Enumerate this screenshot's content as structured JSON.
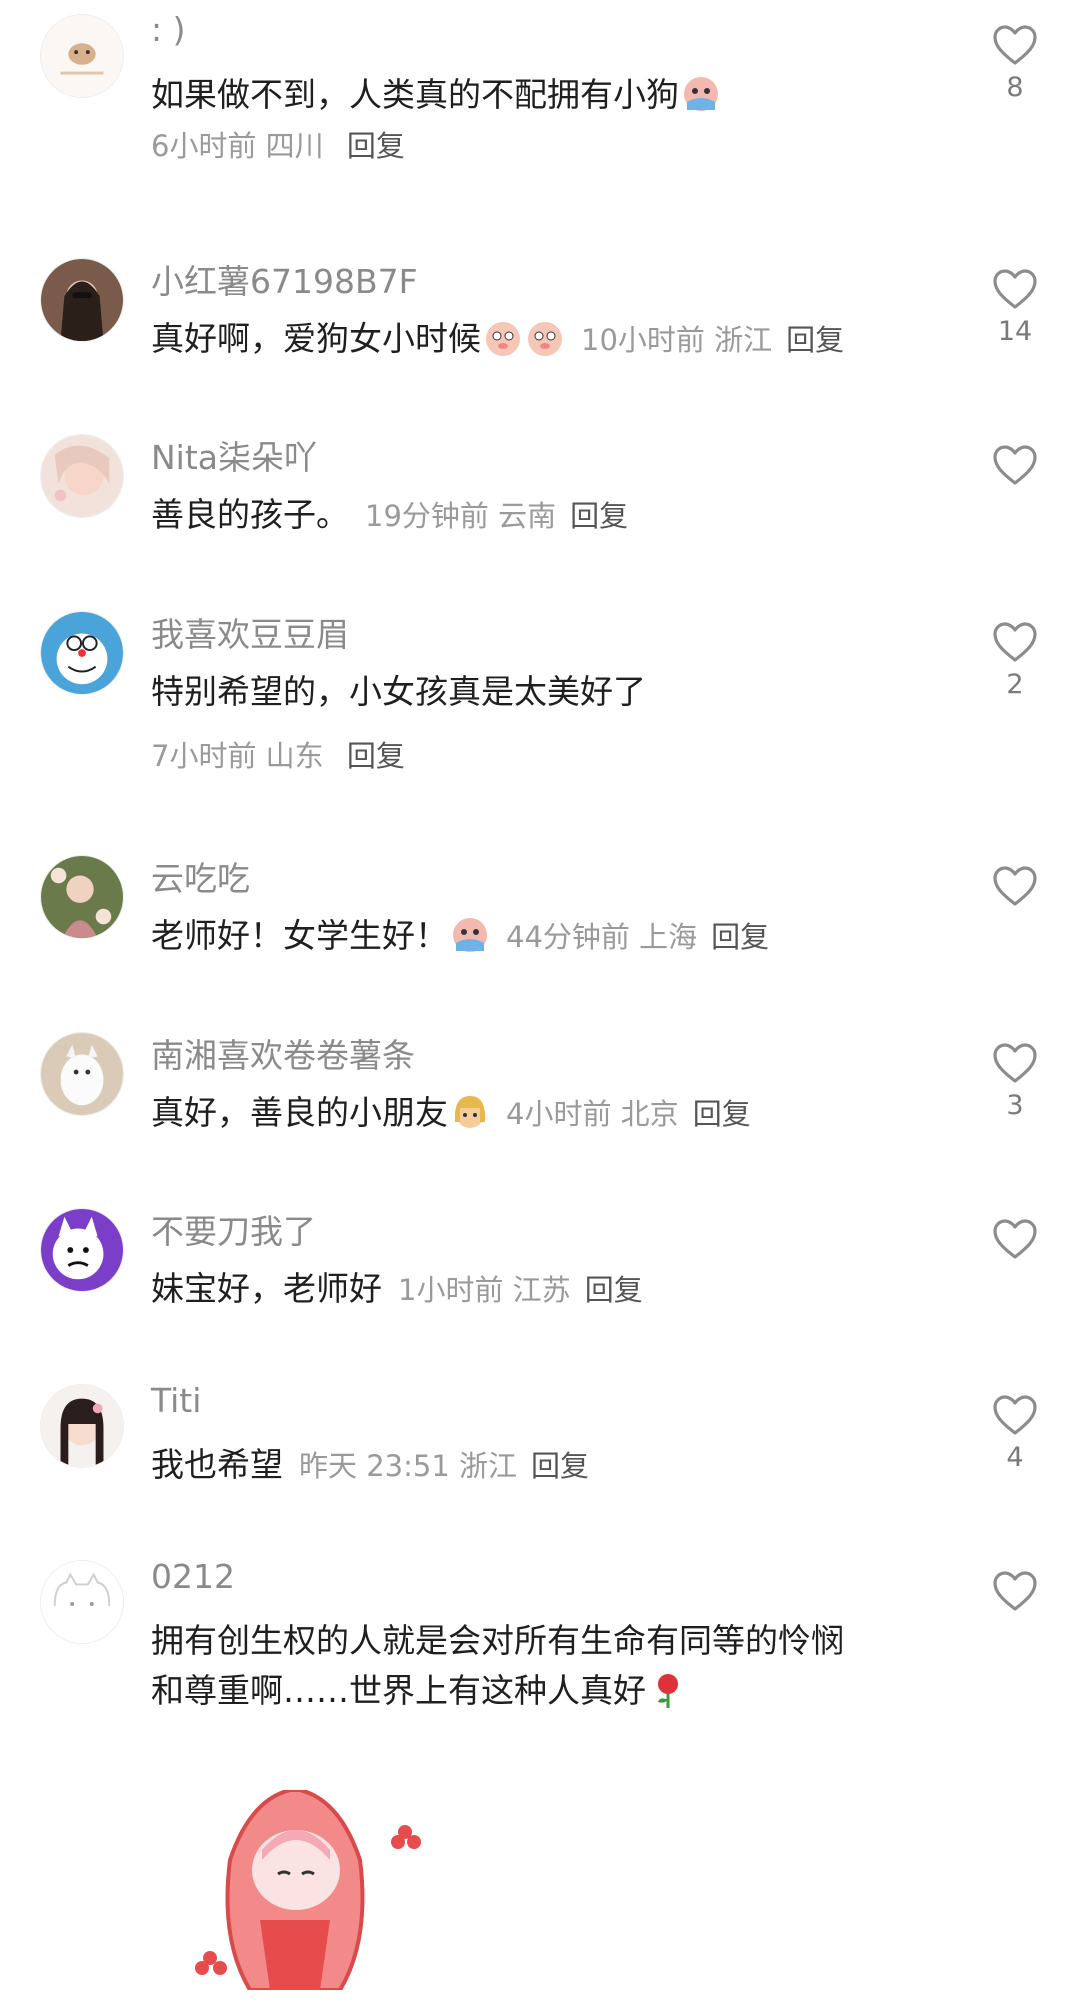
{
  "comments": [
    {
      "name": ": )",
      "text": "如果做不到，人类真的不配拥有小狗",
      "emoji": "crying-emoji",
      "time": "6小时前",
      "location": "四川",
      "reply": "回复",
      "likes": "8"
    },
    {
      "name": "小红薯67198B7F",
      "text": "真好啊，爱狗女小时候",
      "emoji": "crying-pig-emoji x2",
      "time": "10小时前",
      "location": "浙江",
      "reply": "回复",
      "likes": "14"
    },
    {
      "name": "Nita柒朵吖",
      "text": "善良的孩子。",
      "time": "19分钟前",
      "location": "云南",
      "reply": "回复",
      "likes": ""
    },
    {
      "name": "我喜欢豆豆眉",
      "text": "特别希望的，小女孩真是太美好了",
      "time": "7小时前",
      "location": "山东",
      "reply": "回复",
      "likes": "2"
    },
    {
      "name": "云吃吃",
      "text": "老师好！女学生好！",
      "emoji": "crying-emoji",
      "time": "44分钟前",
      "location": "上海",
      "reply": "回复",
      "likes": ""
    },
    {
      "name": "南湘喜欢卷卷薯条",
      "text": "真好，善良的小朋友",
      "emoji": "girl-emoji",
      "time": "4小时前",
      "location": "北京",
      "reply": "回复",
      "likes": "3"
    },
    {
      "name": "不要刀我了",
      "text": "妹宝好，老师好",
      "time": "1小时前",
      "location": "江苏",
      "reply": "回复",
      "likes": ""
    },
    {
      "name": "Titi",
      "text": "我也希望",
      "time": "昨天 23:51",
      "location": "浙江",
      "reply": "回复",
      "likes": "4"
    },
    {
      "name": "0212",
      "text_line1": "拥有创生权的人就是会对所有生命有同等的怜悯",
      "text_line2": "和尊重啊……世界上有这种人真好",
      "emoji": "rose-emoji",
      "likes": ""
    }
  ],
  "sticker": "red-hood-girl-sticker",
  "colors": {
    "text": "#1f1f1f",
    "name": "#8a8a8a",
    "meta": "#9a9a9a",
    "heart": "#8c8c8c"
  }
}
